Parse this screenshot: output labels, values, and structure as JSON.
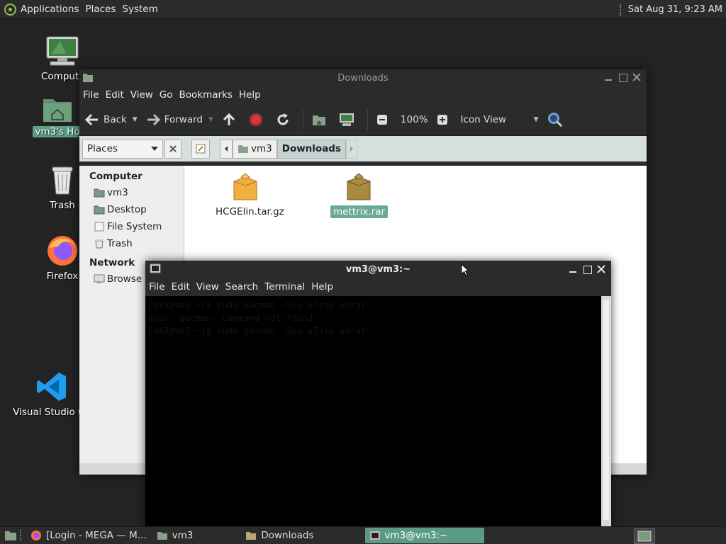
{
  "top_panel": {
    "menus": [
      "Applications",
      "Places",
      "System"
    ],
    "clock": "Sat Aug 31,  9:23 AM"
  },
  "desktop": {
    "icons": [
      {
        "label": "Compute",
        "icon": "computer-icon"
      },
      {
        "label": "vm3's Ho",
        "icon": "home-folder-icon",
        "selected": true
      },
      {
        "label": "Trash",
        "icon": "trash-icon"
      },
      {
        "label": "Firefox",
        "icon": "firefox-icon"
      },
      {
        "label": "Visual Studio Co",
        "icon": "vscode-icon"
      }
    ]
  },
  "file_manager": {
    "title": "Downloads",
    "menu": [
      "File",
      "Edit",
      "View",
      "Go",
      "Bookmarks",
      "Help"
    ],
    "toolbar": {
      "back": "Back",
      "forward": "Forward",
      "zoom": "100%",
      "view_mode": "Icon View"
    },
    "location": {
      "places_label": "Places",
      "crumbs": [
        "vm3",
        "Downloads"
      ]
    },
    "sidebar": {
      "computer_heading": "Computer",
      "computer_items": [
        "vm3",
        "Desktop",
        "File System",
        "Trash"
      ],
      "network_heading": "Network",
      "network_items": [
        "Browse N"
      ]
    },
    "files": [
      {
        "name": "HCGElin.tar.gz",
        "icon": "archive-icon",
        "selected": false
      },
      {
        "name": "mettrix.rar",
        "icon": "archive-icon",
        "selected": true
      }
    ]
  },
  "terminal": {
    "title": "vm3@vm3:~",
    "menu": [
      "File",
      "Edit",
      "View",
      "Search",
      "Terminal",
      "Help"
    ],
    "lines": [
      "[vm3@vm3 ~]$ sudo pacman -Syu p7zip unrar",
      "sudo: pacman: command not found",
      "[vm3@vm3 ~]$ sudo pacman -Syu p7zip unrar"
    ]
  },
  "taskbar": {
    "tasks": [
      {
        "label": "[Login - MEGA — M...",
        "icon": "firefox-icon",
        "active": false
      },
      {
        "label": "vm3",
        "icon": "home-folder-icon",
        "active": false
      },
      {
        "label": "Downloads",
        "icon": "folder-icon",
        "active": false
      },
      {
        "label": "vm3@vm3:~",
        "icon": "terminal-icon",
        "active": true
      }
    ]
  },
  "colors": {
    "selection": "#5aa08a",
    "panel": "#2b2b2b",
    "desktop": "#232323"
  }
}
